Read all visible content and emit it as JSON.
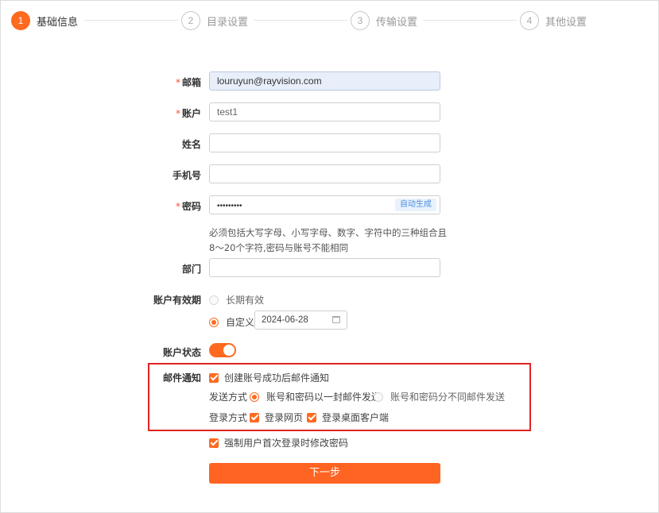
{
  "steps": [
    {
      "num": "1",
      "label": "基础信息"
    },
    {
      "num": "2",
      "label": "目录设置"
    },
    {
      "num": "3",
      "label": "传输设置"
    },
    {
      "num": "4",
      "label": "其他设置"
    }
  ],
  "form": {
    "required_mark": "*",
    "email": {
      "label": "邮箱",
      "value": "louruyun@rayvision.com"
    },
    "account": {
      "label": "账户",
      "value": "test1"
    },
    "name": {
      "label": "姓名",
      "value": ""
    },
    "phone": {
      "label": "手机号",
      "value": ""
    },
    "password": {
      "label": "密码",
      "value": "•••••••••",
      "autogen_label": "自动生成"
    },
    "password_hint": "必须包括大写字母、小写字母、数字、字符中的三种组合且8～20个字符,密码与账号不能相同",
    "department": {
      "label": "部门",
      "value": ""
    },
    "validity": {
      "label": "账户有效期",
      "option_forever": "长期有效",
      "option_custom": "自定义",
      "date": "2024-06-28",
      "selected": "custom"
    },
    "status": {
      "label": "账户状态",
      "enabled": true
    },
    "mail_notify": {
      "label": "邮件通知",
      "create_notify": "创建账号成功后邮件通知",
      "send_method_label": "发送方式",
      "send_option_single": "账号和密码以一封邮件发送",
      "send_option_separate": "账号和密码分不同邮件发送",
      "login_method_label": "登录方式",
      "login_web": "登录网页",
      "login_desktop": "登录桌面客户端"
    },
    "force_change": "强制用户首次登录时修改密码",
    "next_button": "下一步"
  },
  "colors": {
    "accent": "#ff6a1f",
    "highlight_border": "#e02424",
    "required": "#f5503b"
  }
}
